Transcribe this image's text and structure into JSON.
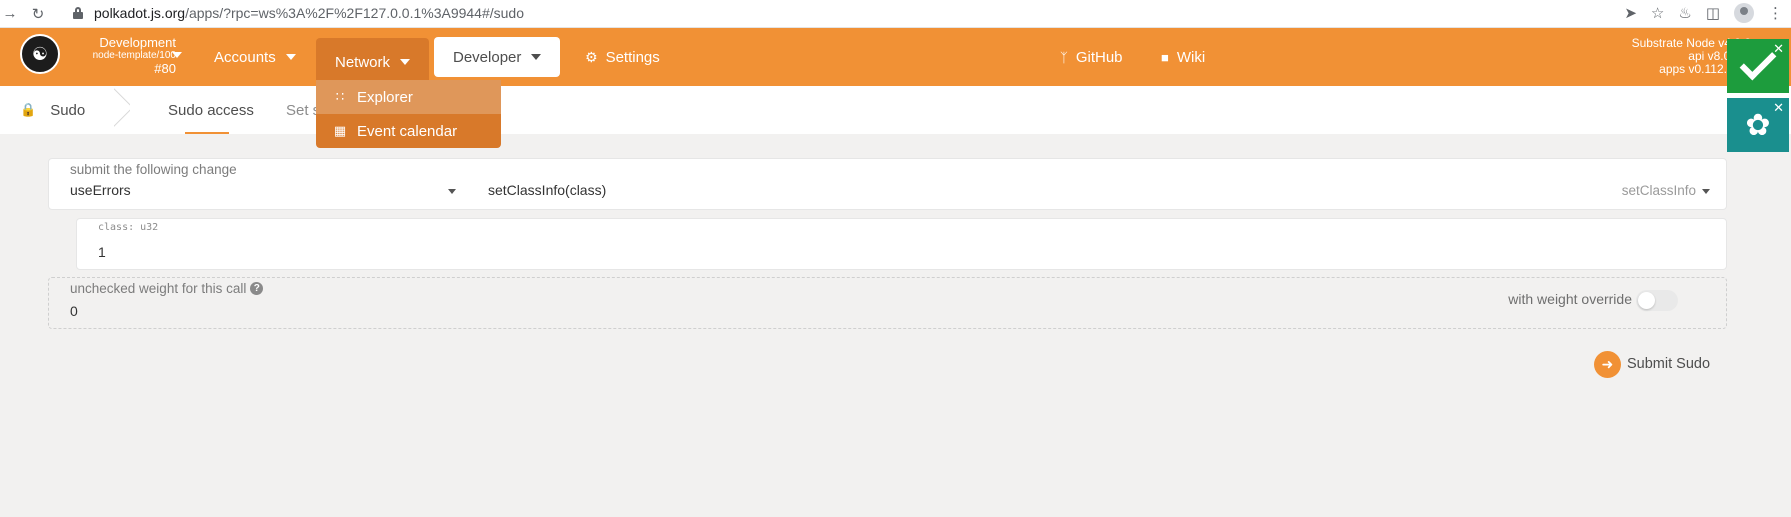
{
  "browser": {
    "host": "polkadot.js.org",
    "path": "/apps/?rpc=ws%3A%2F%2F127.0.0.1%3A9944#/sudo",
    "icons": [
      "back-icon",
      "reload-icon",
      "lock-icon",
      "send-icon",
      "star-icon",
      "puzzle-icon",
      "sidebar-icon",
      "profile-icon",
      "kebab-icon"
    ]
  },
  "chain": {
    "name": "Development",
    "runtime": "node-template/100",
    "block": "#80"
  },
  "nav": {
    "accounts": "Accounts",
    "network": "Network",
    "developer": "Developer",
    "settings": "Settings",
    "github": "GitHub",
    "wiki": "Wiki"
  },
  "network_menu": {
    "items": [
      {
        "label": "Explorer",
        "icon": "grid-icon"
      },
      {
        "label": "Event calendar",
        "icon": "calendar-icon"
      }
    ]
  },
  "version": {
    "node": "Substrate Node v4.0.0",
    "api": "api v8.0.3-1",
    "apps": "apps v0.112.2-18"
  },
  "tabs": {
    "section": "Sudo",
    "sudo_access": "Sudo access",
    "set_sudo": "Set s"
  },
  "form": {
    "change_label": "submit the following change",
    "section_value": "useErrors",
    "method_value": "setClassInfo(class)",
    "method_hint": "setClassInfo",
    "param_label": "class: u32",
    "param_value": "1",
    "weight_label": "unchecked weight for this call",
    "weight_value": "0",
    "override_label": "with weight override",
    "override_enabled": false,
    "submit_label": "Submit Sudo"
  },
  "colors": {
    "brand": "#f19135",
    "menu_active": "#d8792a",
    "success": "#1d9c3d",
    "info": "#1a8f8e"
  }
}
